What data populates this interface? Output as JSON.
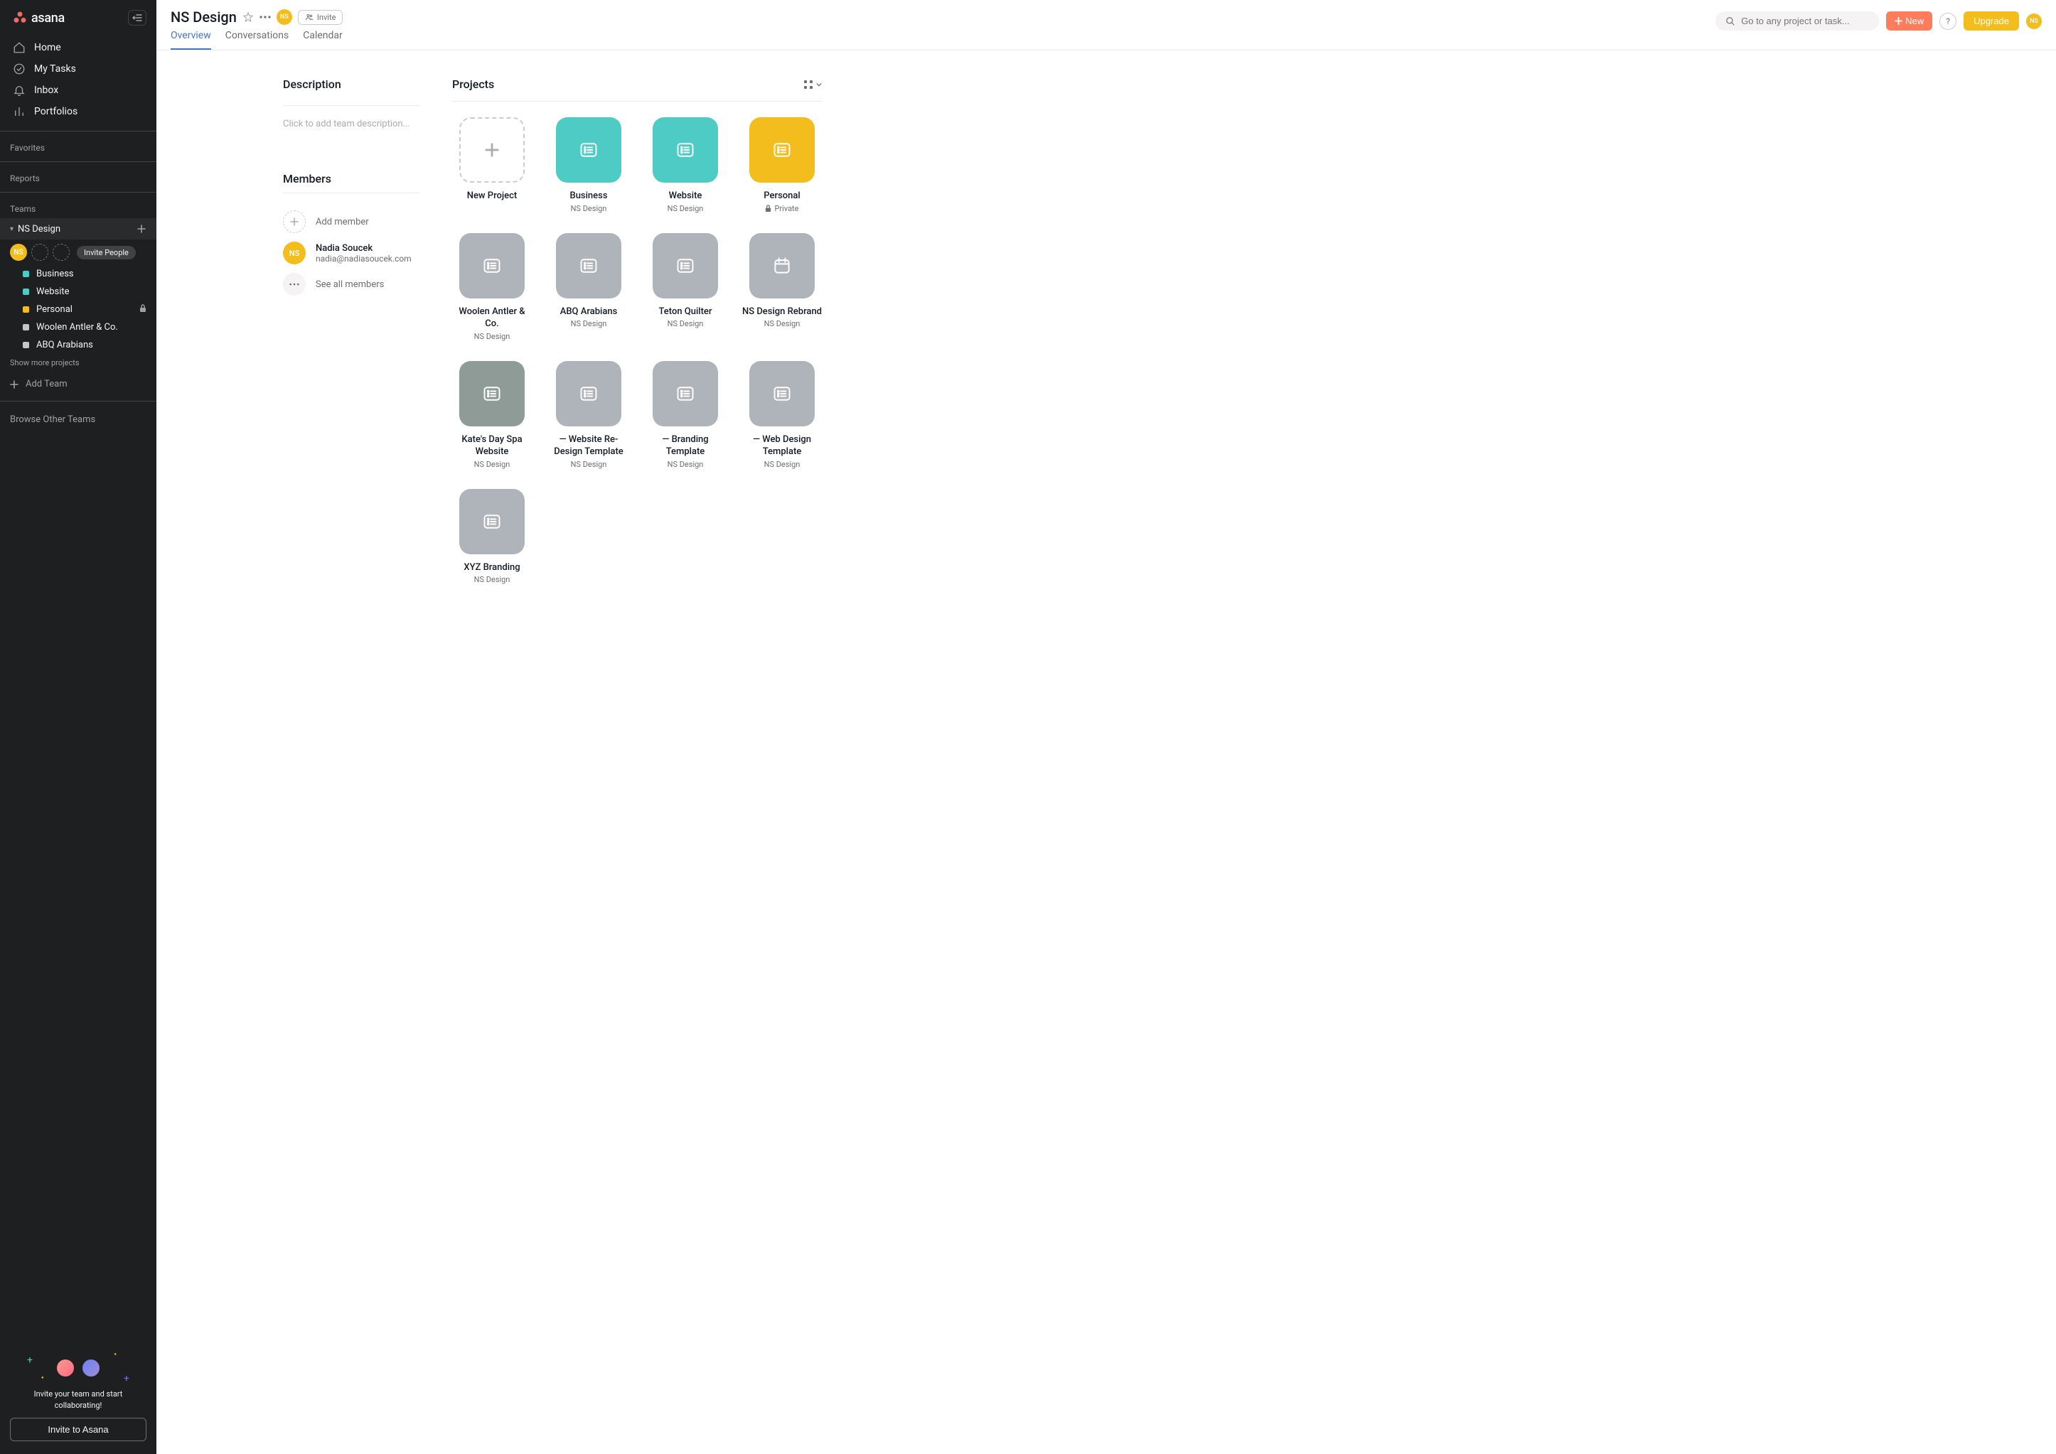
{
  "brand": {
    "name": "asana"
  },
  "sidebar": {
    "nav": [
      {
        "label": "Home",
        "icon": "home"
      },
      {
        "label": "My Tasks",
        "icon": "check"
      },
      {
        "label": "Inbox",
        "icon": "bell"
      },
      {
        "label": "Portfolios",
        "icon": "bars"
      }
    ],
    "favorites_label": "Favorites",
    "reports_label": "Reports",
    "teams_label": "Teams",
    "team_name": "NS Design",
    "member_initials": "NS",
    "invite_people_label": "Invite People",
    "projects": [
      {
        "label": "Business",
        "color": "#4ecbc4",
        "locked": false
      },
      {
        "label": "Website",
        "color": "#4ecbc4",
        "locked": false
      },
      {
        "label": "Personal",
        "color": "#f2bd1d",
        "locked": true
      },
      {
        "label": "Woolen Antler & Co.",
        "color": "#c7c4c4",
        "locked": false
      },
      {
        "label": "ABQ Arabians",
        "color": "#c7c4c4",
        "locked": false
      }
    ],
    "show_more_label": "Show more projects",
    "add_team_label": "Add Team",
    "browse_teams_label": "Browse Other Teams",
    "promo_text_1": "Invite your team and start",
    "promo_text_2": "collaborating!",
    "invite_button_label": "Invite to Asana"
  },
  "header": {
    "title": "NS Design",
    "avatar_initials": "NS",
    "invite_label": "Invite",
    "tabs": [
      {
        "label": "Overview",
        "active": true
      },
      {
        "label": "Conversations",
        "active": false
      },
      {
        "label": "Calendar",
        "active": false
      }
    ],
    "search_placeholder": "Go to any project or task...",
    "new_label": "New",
    "upgrade_label": "Upgrade",
    "user_initials": "NS"
  },
  "content": {
    "description_heading": "Description",
    "description_placeholder": "Click to add team description...",
    "members_heading": "Members",
    "add_member_label": "Add member",
    "member": {
      "name": "Nadia Soucek",
      "email": "nadia@nadiasoucek.com",
      "initials": "NS"
    },
    "see_all_label": "See all members",
    "projects_heading": "Projects",
    "new_project_label": "New Project",
    "projects": [
      {
        "name": "Business",
        "sub": "NS Design",
        "color": "#4ecbc4",
        "icon": "list"
      },
      {
        "name": "Website",
        "sub": "NS Design",
        "color": "#4ecbc4",
        "icon": "list"
      },
      {
        "name": "Personal",
        "sub": "Private",
        "color": "#f2bd1d",
        "icon": "list",
        "locked": true
      },
      {
        "name": "Woolen Antler & Co.",
        "sub": "NS Design",
        "color": "#afb4bb",
        "icon": "list"
      },
      {
        "name": "ABQ Arabians",
        "sub": "NS Design",
        "color": "#afb4bb",
        "icon": "list"
      },
      {
        "name": "Teton Quilter",
        "sub": "NS Design",
        "color": "#afb4bb",
        "icon": "list"
      },
      {
        "name": "NS Design Rebrand",
        "sub": "NS Design",
        "color": "#afb4bb",
        "icon": "calendar"
      },
      {
        "name": "Kate's Day Spa Website",
        "sub": "NS Design",
        "color": "#8e9b97",
        "icon": "list"
      },
      {
        "name": "— Website Re-Design Template",
        "sub": "NS Design",
        "color": "#afb4bb",
        "icon": "list"
      },
      {
        "name": "— Branding Template",
        "sub": "NS Design",
        "color": "#afb4bb",
        "icon": "list"
      },
      {
        "name": "— Web Design Template",
        "sub": "NS Design",
        "color": "#afb4bb",
        "icon": "list"
      },
      {
        "name": "XYZ Branding",
        "sub": "NS Design",
        "color": "#afb4bb",
        "icon": "list"
      }
    ]
  }
}
